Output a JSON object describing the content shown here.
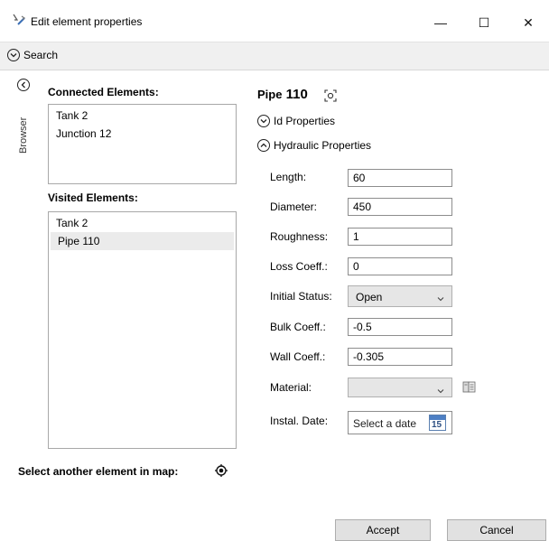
{
  "window": {
    "title": "Edit element properties",
    "minimize": "—",
    "maximize": "☐",
    "close": "✕"
  },
  "search": {
    "label": "Search"
  },
  "browser": {
    "tab_label": "Browser"
  },
  "connected": {
    "title": "Connected Elements:",
    "items": [
      "Tank 2",
      "Junction 12"
    ]
  },
  "visited": {
    "title": "Visited Elements:",
    "items": [
      "Tank 2",
      "Pipe 110"
    ],
    "selected_index": 1
  },
  "element": {
    "type": "Pipe",
    "id": "110"
  },
  "sections": {
    "id_properties": "Id Properties",
    "hydraulic_properties": "Hydraulic Properties"
  },
  "fields": {
    "length": {
      "label": "Length:",
      "value": "60"
    },
    "diameter": {
      "label": "Diameter:",
      "value": "450"
    },
    "roughness": {
      "label": "Roughness:",
      "value": "1"
    },
    "loss_coeff": {
      "label": "Loss Coeff.:",
      "value": "0"
    },
    "initial_status": {
      "label": "Initial Status:",
      "value": "Open"
    },
    "bulk_coeff": {
      "label": "Bulk Coeff.:",
      "value": "-0.5"
    },
    "wall_coeff": {
      "label": "Wall Coeff.:",
      "value": "-0.305"
    },
    "material": {
      "label": "Material:",
      "value": ""
    },
    "instal_date": {
      "label": "Instal. Date:",
      "placeholder": "Select a date",
      "calendar_day": "15"
    }
  },
  "footer": {
    "select_in_map": "Select another element in map:",
    "accept": "Accept",
    "cancel": "Cancel"
  }
}
